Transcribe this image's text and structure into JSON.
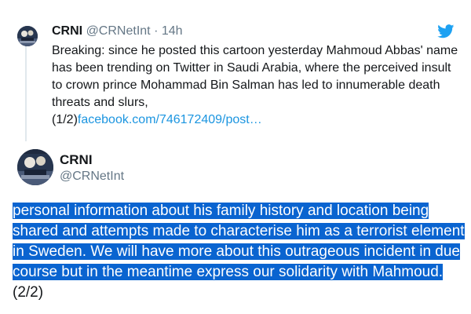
{
  "quoted_tweet": {
    "name": "CRNI",
    "handle": "@CRNetInt",
    "separator": "·",
    "time": "14h",
    "text": "Breaking: since he posted this cartoon yesterday Mahmoud Abbas' name has been trending on Twitter in Saudi Arabia, where the perceived insult to crown prince Mohammad Bin Salman has led to innumerable death threats and slurs,",
    "text_prefix": "(1/2)",
    "link": "facebook.com/746172409/post…",
    "icon": "twitter-bird-icon"
  },
  "main_tweet": {
    "name": "CRNI",
    "handle": "@CRNetInt",
    "selected_text": "personal information about his family history and location being shared and attempts made to characterise him as a terrorist element in Sweden. We will have more about this outrageous incident in due course but in the meantime express our solidarity with Mahmoud.",
    "unselected_text": " (2/2)"
  },
  "colors": {
    "selection": "#0a64d0",
    "link": "#1b95e0",
    "twitter_blue": "#1da1f2",
    "muted": "#657786"
  }
}
